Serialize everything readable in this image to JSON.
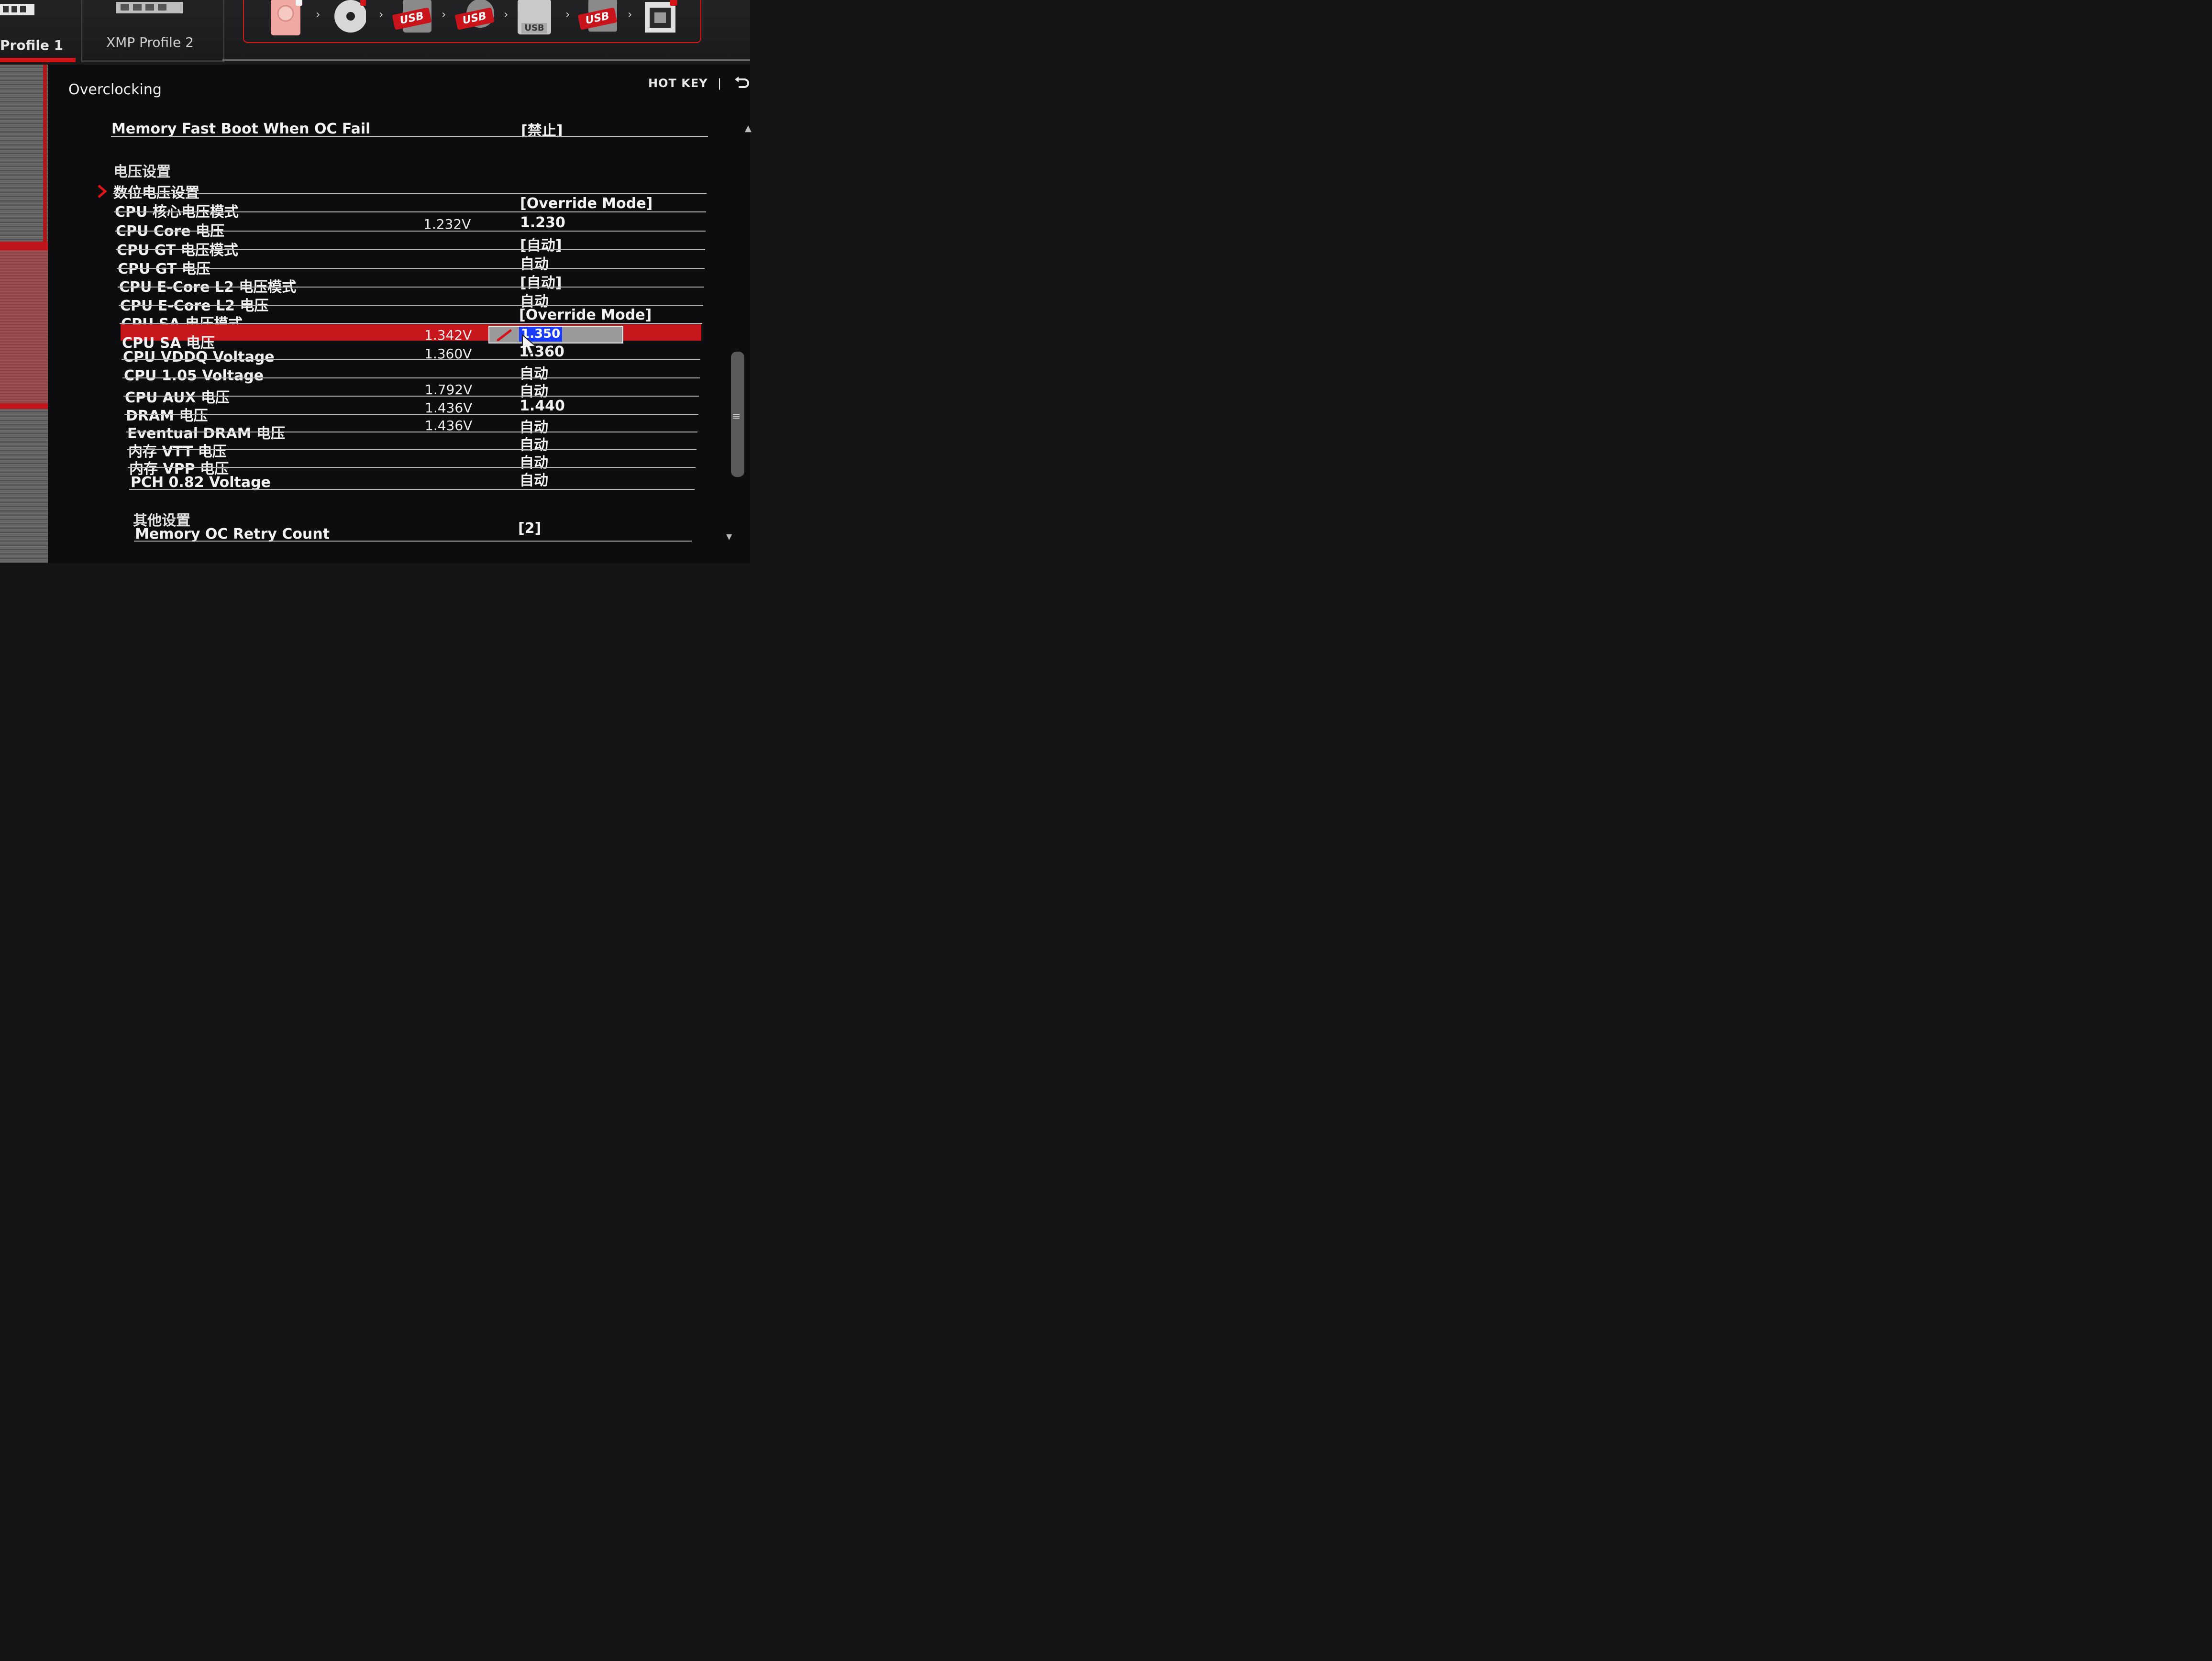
{
  "tabs": [
    {
      "label": "Profile 1"
    },
    {
      "label": "XMP Profile 2"
    }
  ],
  "boot_devices": [
    {
      "icon": "hdd-icon",
      "badge": ""
    },
    {
      "icon": "optical-disc-icon",
      "badge": ""
    },
    {
      "icon": "usb-hdd-icon",
      "badge": "USB"
    },
    {
      "icon": "usb-cd-icon",
      "badge": "USB"
    },
    {
      "icon": "usb-key-icon",
      "badge": "USB"
    },
    {
      "icon": "usb-floppy-icon",
      "badge": "USB"
    },
    {
      "icon": "network-icon",
      "badge": ""
    }
  ],
  "header": {
    "section_title": "Overclocking",
    "hotkey": "HOT KEY",
    "hotkey_sep": "|"
  },
  "settings": {
    "memory_fast_boot": {
      "label": "Memory Fast Boot When OC Fail",
      "value": "[禁止]"
    },
    "voltage_heading": "电压设置",
    "digital_voltage": {
      "label": "数位电压设置"
    },
    "rows": [
      {
        "label": "CPU 核心电压模式",
        "current": "",
        "value": "[Override Mode]"
      },
      {
        "label": "CPU Core 电压",
        "current": "1.232V",
        "value": "1.230"
      },
      {
        "label": "CPU GT 电压模式",
        "current": "",
        "value": "[自动]"
      },
      {
        "label": "CPU GT 电压",
        "current": "",
        "value": "自动"
      },
      {
        "label": "CPU E-Core L2 电压模式",
        "current": "",
        "value": "[自动]"
      },
      {
        "label": "CPU E-Core L2 电压",
        "current": "",
        "value": "自动"
      },
      {
        "label": "CPU SA 电压模式",
        "current": "",
        "value": "[Override Mode]"
      },
      {
        "label": "CPU SA 电压",
        "current": "1.342V",
        "value": "1.350"
      },
      {
        "label": "CPU VDDQ Voltage",
        "current": "1.360V",
        "value": "1.360"
      },
      {
        "label": "CPU 1.05 Voltage",
        "current": "",
        "value": "自动"
      },
      {
        "label": "CPU AUX 电压",
        "current": "1.792V",
        "value": "自动"
      },
      {
        "label": "DRAM 电压",
        "current": "1.436V",
        "value": "1.440"
      },
      {
        "label": "Eventual DRAM 电压",
        "current": "1.436V",
        "value": "自动"
      },
      {
        "label": "内存 VTT 电压",
        "current": "",
        "value": "自动"
      },
      {
        "label": "内存 VPP 电压",
        "current": "",
        "value": "自动"
      },
      {
        "label": "PCH 0.82 Voltage",
        "current": "",
        "value": "自动"
      }
    ],
    "other_heading": "其他设置",
    "memory_retry": {
      "label": "Memory OC Retry Count",
      "value": "[2]"
    }
  },
  "colors": {
    "accent": "#d3151a",
    "edit_highlight": "#1a3cff"
  }
}
